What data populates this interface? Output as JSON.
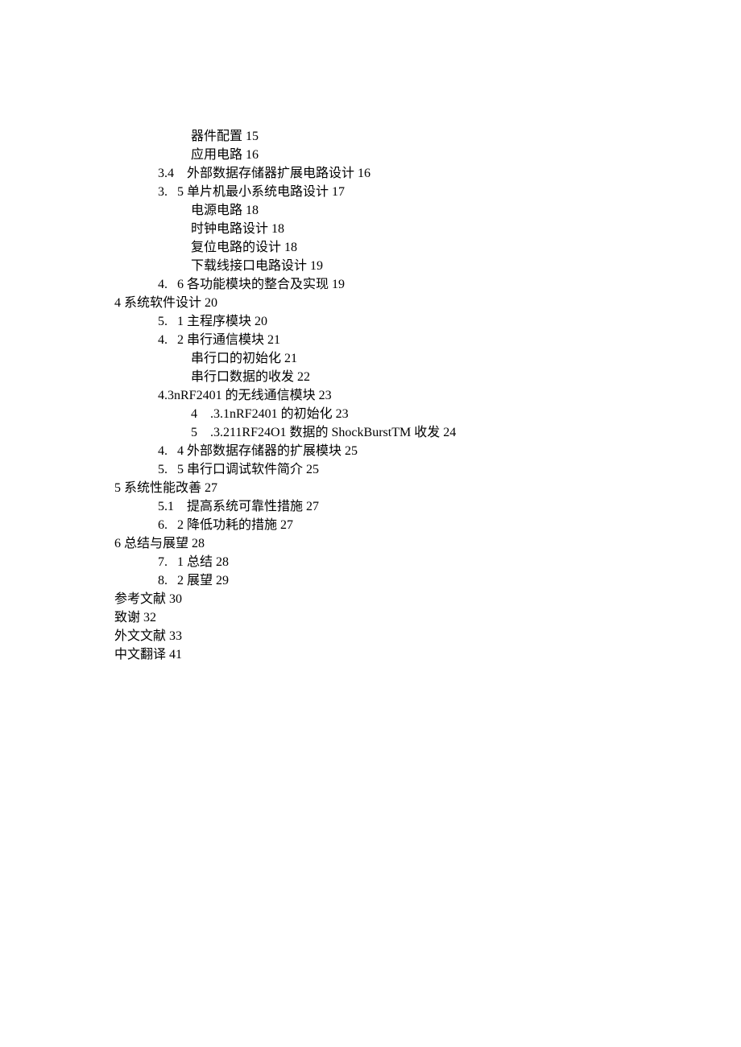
{
  "lines": [
    {
      "cls": "i2",
      "t": "器件配置 15"
    },
    {
      "cls": "i2",
      "t": "应用电路 16"
    },
    {
      "cls": "i1",
      "t": "3.4    外部数据存储器扩展电路设计 16"
    },
    {
      "cls": "i1",
      "t": "3.   5 单片机最小系统电路设计 17"
    },
    {
      "cls": "i2",
      "t": "电源电路 18"
    },
    {
      "cls": "i2",
      "t": "时钟电路设计 18"
    },
    {
      "cls": "i2",
      "t": "复位电路的设计 18"
    },
    {
      "cls": "i2",
      "t": "下载线接口电路设计 19"
    },
    {
      "cls": "i1",
      "t": "4.   6 各功能模块的整合及实现 19"
    },
    {
      "cls": "i0",
      "t": "4 系统软件设计 20"
    },
    {
      "cls": "i1",
      "t": "5.   1 主程序模块 20"
    },
    {
      "cls": "i1",
      "t": "4.   2 串行通信模块 21"
    },
    {
      "cls": "i2",
      "t": "串行口的初始化 21"
    },
    {
      "cls": "i2",
      "t": "串行口数据的收发 22"
    },
    {
      "cls": "i1",
      "t": "4.3nRF2401 的无线通信模块 23"
    },
    {
      "cls": "i2n",
      "t": "4    .3.1nRF2401 的初始化 23"
    },
    {
      "cls": "i2n",
      "t": "5    .3.211RF24O1 数据的 ShockBurstTM 收发 24"
    },
    {
      "cls": "i1",
      "t": "4.   4 外部数据存储器的扩展模块 25"
    },
    {
      "cls": "i1",
      "t": "5.   5 串行口调试软件简介 25"
    },
    {
      "cls": "i0",
      "t": "5 系统性能改善 27"
    },
    {
      "cls": "i1",
      "t": "5.1    提高系统可靠性措施 27"
    },
    {
      "cls": "i1",
      "t": "6.   2 降低功耗的措施 27"
    },
    {
      "cls": "i0",
      "t": "6 总结与展望 28"
    },
    {
      "cls": "i1",
      "t": "7.   1 总结 28"
    },
    {
      "cls": "i1",
      "t": "8.   2 展望 29"
    },
    {
      "cls": "i0",
      "t": "参考文献 30"
    },
    {
      "cls": "i0",
      "t": "致谢 32"
    },
    {
      "cls": "i0",
      "t": "外文文献 33"
    },
    {
      "cls": "i0",
      "t": "中文翻译 41"
    }
  ]
}
